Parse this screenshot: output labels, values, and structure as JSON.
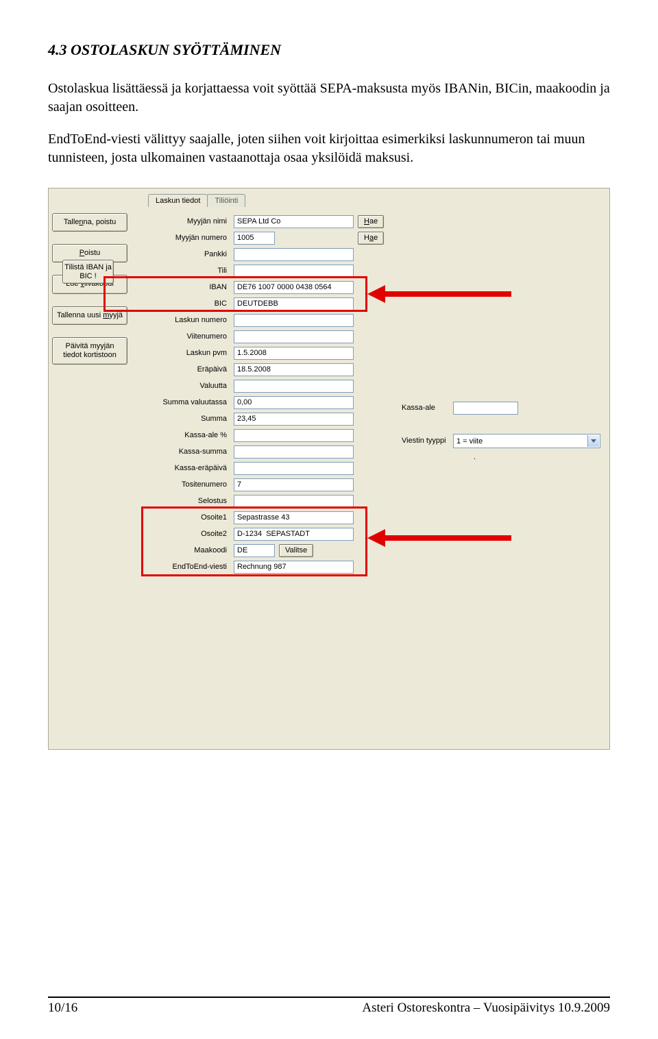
{
  "doc": {
    "heading": "4.3 OSTOLASKUN SYÖTTÄMINEN",
    "para1": "Ostolaskua lisättäessä ja korjattaessa voit syöttää SEPA-maksusta myös IBANin, BICin, maakoodin ja saajan osoitteen.",
    "para2": "EndToEnd-viesti välittyy saajalle, joten siihen voit kirjoittaa esimerkiksi laskunnumeron tai muun tunnisteen, josta ulkomainen vastaanottaja osaa yksilöidä maksusi."
  },
  "leftButtons": {
    "save_delete": "Tallenna, poistu",
    "exit": "Poistu",
    "read_barcode": "Lue viivakoodi",
    "save_new_seller": "Tallenna uusi myyjä",
    "update_seller": "Päivitä myyjän tiedot kortistoon",
    "iban_side": "Tilistä IBAN ja BIC !"
  },
  "tabs": {
    "tab1": "Laskun tiedot",
    "tab2": "Tiliöinti"
  },
  "form": {
    "seller_name_label": "Myyjän nimi",
    "seller_name_value": "SEPA Ltd Co",
    "hae_btn": "Hae",
    "seller_no_label": "Myyjän numero",
    "seller_no_value": "1005",
    "bank_label": "Pankki",
    "acct_label": "Tili",
    "iban_label": "IBAN",
    "iban_value": "DE76 1007 0000 0438 0564",
    "bic_label": "BIC",
    "bic_value": "DEUTDEBB",
    "invno_label": "Laskun numero",
    "refno_label": "Viitenumero",
    "invdate_label": "Laskun pvm",
    "invdate_value": "1.5.2008",
    "duedate_label": "Eräpäivä",
    "duedate_value": "18.5.2008",
    "currency_label": "Valuutta",
    "amt_cur_label": "Summa valuutassa",
    "amt_cur_value": "0,00",
    "amt_label": "Summa",
    "amt_value": "23,45",
    "disc_label": "Kassa-ale %",
    "discsum_label": "Kassa-summa",
    "discdue_label": "Kassa-eräpäivä",
    "voucher_label": "Tositenumero",
    "voucher_value": "7",
    "desc_label": "Selostus",
    "addr1_label": "Osoite1",
    "addr1_value": "Sepastrasse 43",
    "addr2_label": "Osoite2",
    "addr2_value": "D-1234  SEPASTADT",
    "country_label": "Maakoodi",
    "country_value": "DE",
    "valitse_btn": "Valitse",
    "e2e_label": "EndToEnd-viesti",
    "e2e_value": "Rechnung 987",
    "right_kassa_label": "Kassa-ale",
    "right_msgtype_label": "Viestin tyyppi",
    "right_msgtype_value": "1 = viite",
    "dot": "."
  },
  "footer": {
    "left": "10/16",
    "right": "Asteri Ostoreskontra – Vuosipäivitys 10.9.2009"
  }
}
